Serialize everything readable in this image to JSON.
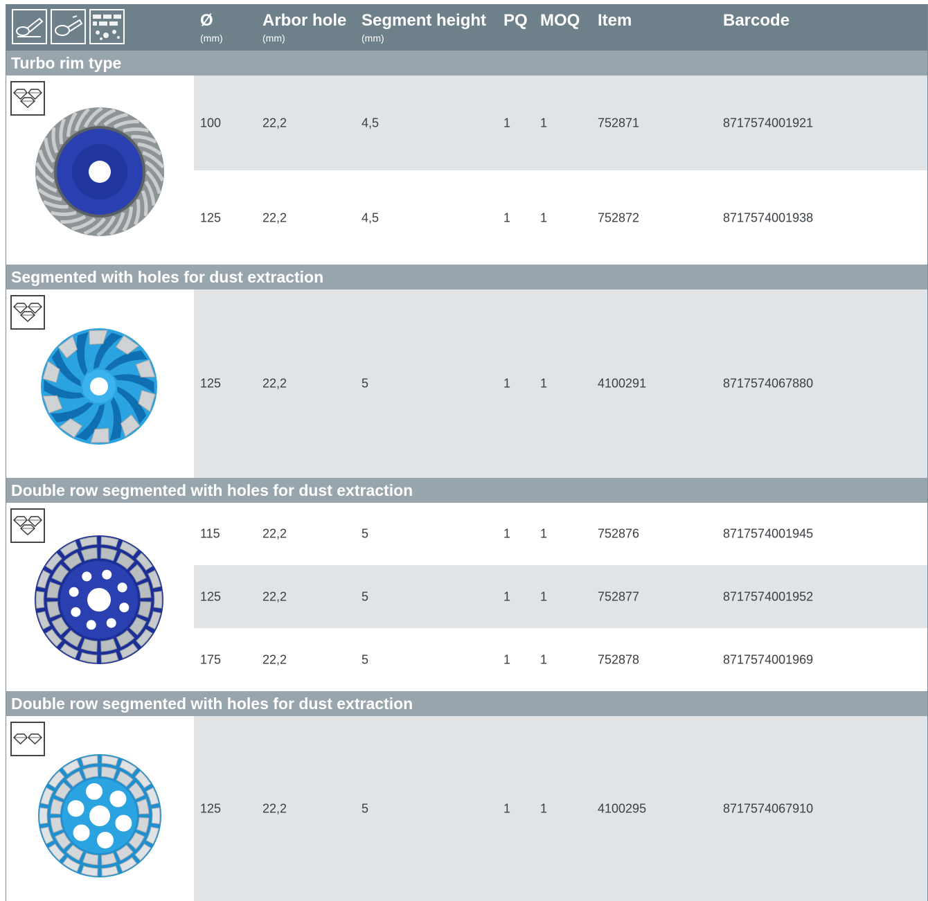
{
  "header": {
    "icons": [
      "angle-grinder-small-icon",
      "angle-grinder-large-icon",
      "masonry-material-icon"
    ],
    "columns": [
      {
        "key": "diameter",
        "label": "Ø",
        "unit": "(mm)"
      },
      {
        "key": "arbor",
        "label": "Arbor hole",
        "unit": "(mm)"
      },
      {
        "key": "segment",
        "label": "Segment height",
        "unit": "(mm)"
      },
      {
        "key": "pq",
        "label": "PQ",
        "unit": ""
      },
      {
        "key": "moq",
        "label": "MOQ",
        "unit": ""
      },
      {
        "key": "item",
        "label": "Item",
        "unit": ""
      },
      {
        "key": "barcode",
        "label": "Barcode",
        "unit": ""
      }
    ]
  },
  "sections": [
    {
      "title": "Turbo rim type",
      "badge_icon": "diamond-grade-3-icon",
      "wheel_icon": "turbo-cup-wheel-icon",
      "rows": [
        {
          "diameter": "100",
          "arbor": "22,2",
          "segment": "4,5",
          "pq": "1",
          "moq": "1",
          "item": "752871",
          "barcode": "8717574001921"
        },
        {
          "diameter": "125",
          "arbor": "22,2",
          "segment": "4,5",
          "pq": "1",
          "moq": "1",
          "item": "752872",
          "barcode": "8717574001938"
        }
      ]
    },
    {
      "title": "Segmented with holes for dust extraction",
      "badge_icon": "diamond-grade-3-icon",
      "wheel_icon": "spiral-segment-cup-wheel-icon",
      "rows": [
        {
          "diameter": "125",
          "arbor": "22,2",
          "segment": "5",
          "pq": "1",
          "moq": "1",
          "item": "4100291",
          "barcode": "8717574067880"
        }
      ]
    },
    {
      "title": "Double row segmented with holes for dust extraction",
      "badge_icon": "diamond-grade-3-icon",
      "wheel_icon": "double-row-cup-wheel-dark-icon",
      "rows": [
        {
          "diameter": "115",
          "arbor": "22,2",
          "segment": "5",
          "pq": "1",
          "moq": "1",
          "item": "752876",
          "barcode": "8717574001945"
        },
        {
          "diameter": "125",
          "arbor": "22,2",
          "segment": "5",
          "pq": "1",
          "moq": "1",
          "item": "752877",
          "barcode": "8717574001952"
        },
        {
          "diameter": "175",
          "arbor": "22,2",
          "segment": "5",
          "pq": "1",
          "moq": "1",
          "item": "752878",
          "barcode": "8717574001969"
        }
      ]
    },
    {
      "title": "Double row segmented with holes for dust extraction",
      "badge_icon": "diamond-grade-2-icon",
      "wheel_icon": "double-row-cup-wheel-light-icon",
      "rows": [
        {
          "diameter": "125",
          "arbor": "22,2",
          "segment": "5",
          "pq": "1",
          "moq": "1",
          "item": "4100295",
          "barcode": "8717574067910"
        }
      ]
    }
  ],
  "colors": {
    "header_bg": "#6e8089",
    "section_bg": "#98a5ac",
    "row_shade": "#e1e4e7",
    "wheel_dark_blue": "#2a3fb0",
    "wheel_light_blue": "#2ba3e0"
  }
}
